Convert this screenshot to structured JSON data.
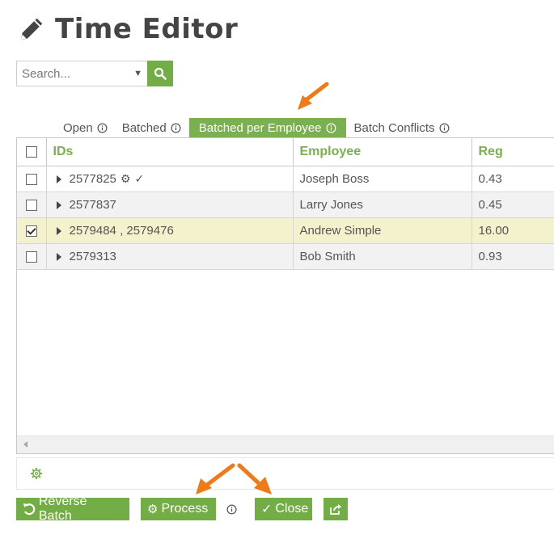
{
  "header": {
    "title": "Time Editor",
    "icon": "pencil-icon"
  },
  "search": {
    "placeholder": "Search..."
  },
  "tabs": [
    {
      "label": "Open",
      "active": false
    },
    {
      "label": "Batched",
      "active": false
    },
    {
      "label": "Batched per Employee",
      "active": true
    },
    {
      "label": "Batch Conflicts",
      "active": false
    }
  ],
  "table": {
    "columns": [
      "IDs",
      "Employee",
      "Reg"
    ],
    "rows": [
      {
        "checked": false,
        "ids": "2577825",
        "employee": "Joseph Boss",
        "reg": "0.43",
        "has_icons": true,
        "check_glyph": "✓"
      },
      {
        "checked": false,
        "ids": "2577837",
        "employee": "Larry Jones",
        "reg": "0.45"
      },
      {
        "checked": true,
        "ids": "2579484 , 2579476",
        "employee": "Andrew Simple",
        "reg": "16.00"
      },
      {
        "checked": false,
        "ids": "2579313",
        "employee": "Bob Smith",
        "reg": "0.93"
      }
    ]
  },
  "buttons": {
    "reverse_batch": "Reverse Batch",
    "process": "Process",
    "close": "Close",
    "close_glyph": "✓"
  },
  "colors": {
    "accent": "#72ad45",
    "header_text": "#7bb04e",
    "selected_row": "#f4f2cc",
    "arrow": "#f07a18"
  }
}
